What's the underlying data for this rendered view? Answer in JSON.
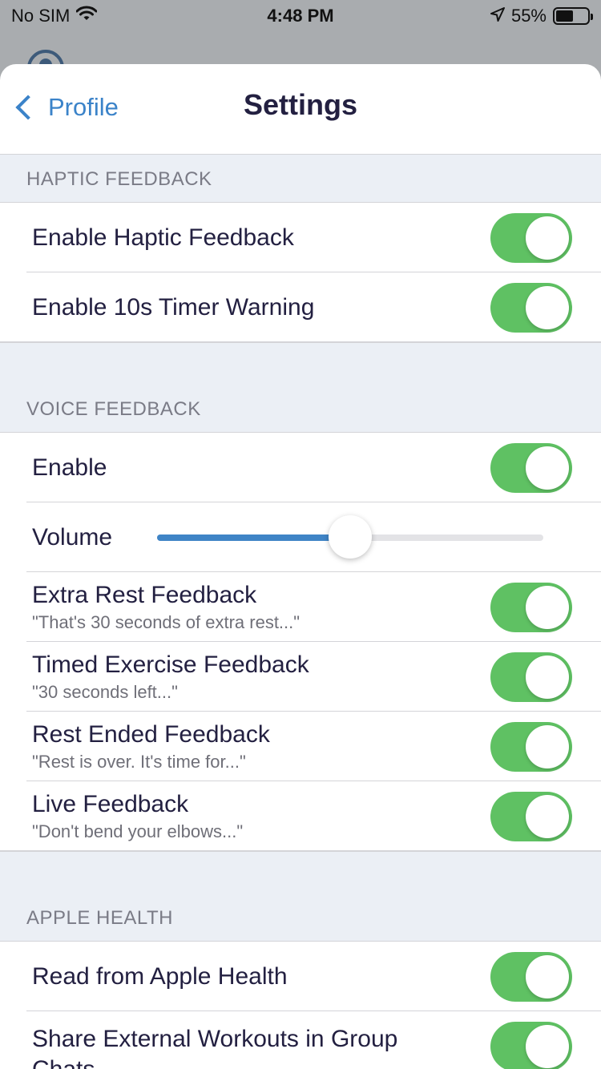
{
  "status_bar": {
    "carrier": "No SIM",
    "time": "4:48 PM",
    "battery": "55%",
    "battery_level": 0.55,
    "icons": [
      "wifi-icon",
      "location-arrow-icon",
      "battery-icon"
    ]
  },
  "nav": {
    "back_label": "Profile",
    "title": "Settings"
  },
  "sections": {
    "haptic": {
      "header": "HAPTIC FEEDBACK",
      "items": [
        {
          "label": "Enable Haptic Feedback",
          "on": true
        },
        {
          "label": "Enable 10s Timer Warning",
          "on": true
        }
      ]
    },
    "voice": {
      "header": "VOICE FEEDBACK",
      "enable": {
        "label": "Enable",
        "on": true
      },
      "volume": {
        "label": "Volume",
        "value": 0.5
      },
      "items": [
        {
          "label": "Extra Rest Feedback",
          "subtitle": "\"That's 30 seconds of extra rest...\"",
          "on": true
        },
        {
          "label": "Timed Exercise Feedback",
          "subtitle": "\"30 seconds left...\"",
          "on": true
        },
        {
          "label": "Rest Ended Feedback",
          "subtitle": "\"Rest is over. It's time for...\"",
          "on": true
        },
        {
          "label": "Live Feedback",
          "subtitle": "\"Don't bend your elbows...\"",
          "on": true
        }
      ]
    },
    "health": {
      "header": "APPLE HEALTH",
      "items": [
        {
          "label": "Read from Apple Health",
          "on": true
        },
        {
          "label": "Share External Workouts in Group Chats",
          "on": true
        }
      ]
    }
  },
  "colors": {
    "accent": "#3b83c9",
    "toggle_on": "#5fc163",
    "section_bg": "#ebeff5",
    "text": "#232041"
  }
}
